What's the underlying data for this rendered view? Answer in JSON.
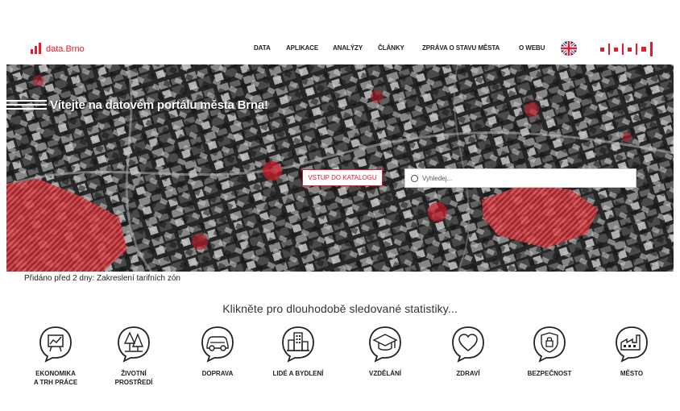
{
  "header": {
    "logo_text": "data.Brno",
    "nav": [
      "DATA",
      "APLIKACE",
      "ANALÝZY",
      "ČLÁNKY",
      "ZPRÁVA O STAVU MĚSTA",
      "O WEBU"
    ],
    "language_icon": "uk-flag-icon",
    "brand_logo_icon": "brno-logo-icon"
  },
  "hero": {
    "title": "Vítejte na datovém portálu města Brna!",
    "catalog_button": "VSTUP DO KATALOGU",
    "search_placeholder": "Vyhledej...",
    "search_icon": "search-icon"
  },
  "news": "Přidáno před 2 dny: Zakreslení tarifních zón",
  "stats_title": "Klikněte pro dlouhodobě sledované statistiky...",
  "categories": [
    {
      "label": "EKONOMIKA\nA TRH PRÁCE",
      "icon": "chart-board-icon"
    },
    {
      "label": "ŽIVOTNÍ\nPROSTŘEDÍ",
      "icon": "trees-icon"
    },
    {
      "label": "DOPRAVA",
      "icon": "car-icon"
    },
    {
      "label": "LIDÉ A BYDLENÍ",
      "icon": "buildings-icon"
    },
    {
      "label": "VZDĚLÁNÍ",
      "icon": "graduation-cap-icon"
    },
    {
      "label": "ZDRAVÍ",
      "icon": "heart-icon"
    },
    {
      "label": "BEZPEČNOST",
      "icon": "shield-lock-icon"
    },
    {
      "label": "MĚSTO",
      "icon": "factory-icon"
    }
  ],
  "colors": {
    "accent": "#e41d2d",
    "text": "#222222"
  }
}
